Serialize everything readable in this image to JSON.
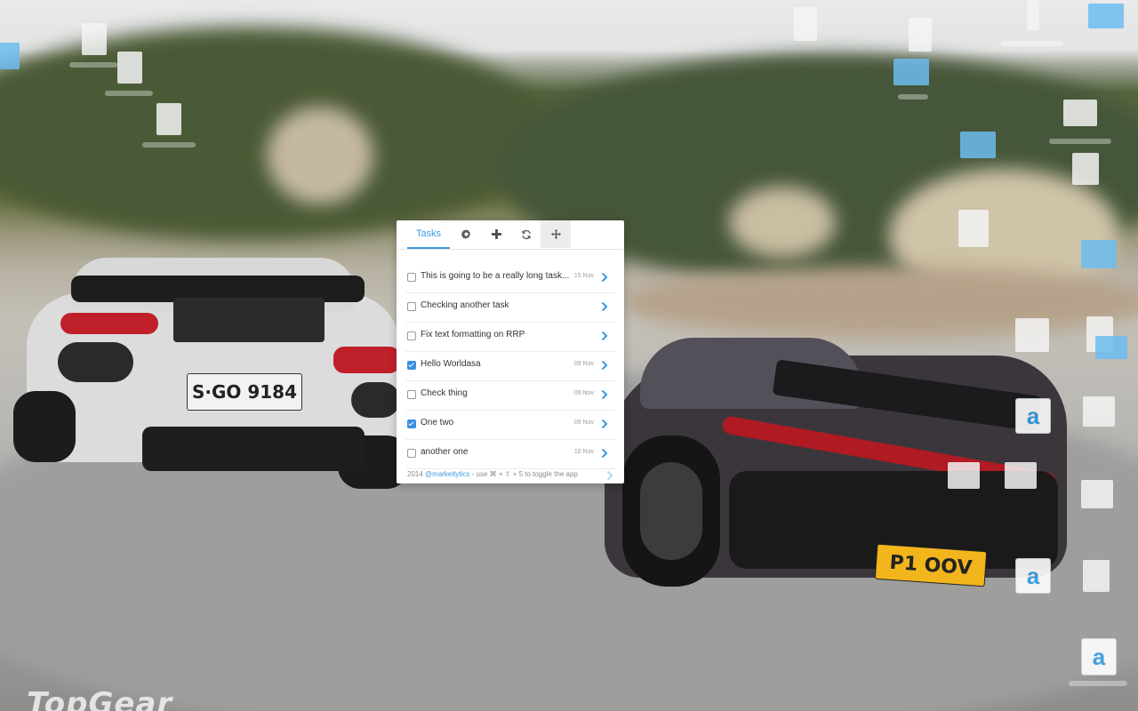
{
  "panel": {
    "tabs": [
      {
        "label": "Tasks",
        "icon": "list"
      },
      {
        "icon": "gear-icon"
      },
      {
        "icon": "plus-icon"
      },
      {
        "icon": "refresh-icon"
      },
      {
        "icon": "move-icon"
      }
    ],
    "tasks": [
      {
        "title": "This is going to be a really long task...",
        "date": "15 Nov",
        "checked": false
      },
      {
        "title": "Checking another task",
        "date": "",
        "checked": false
      },
      {
        "title": "Fix text formatting on RRP",
        "date": "",
        "checked": false
      },
      {
        "title": "Hello Worldasa",
        "date": "09 Nov",
        "checked": true
      },
      {
        "title": "Check thing",
        "date": "09 Nov",
        "checked": false
      },
      {
        "title": "One two",
        "date": "09 Nov",
        "checked": true
      },
      {
        "title": "another one",
        "date": "10 Nov",
        "checked": false
      }
    ],
    "footer": {
      "prefix": "2014",
      "link": "@marketlytics",
      "suffix": "- use ⌘ + ⇧ + 5 to toggle the app"
    }
  },
  "desktop": {
    "plates": [
      "S·GO 9184",
      "P1 OOV"
    ],
    "logo": "TopGear"
  },
  "colors": {
    "accent": "#3a9be0",
    "folder": "#6cbcf0"
  }
}
